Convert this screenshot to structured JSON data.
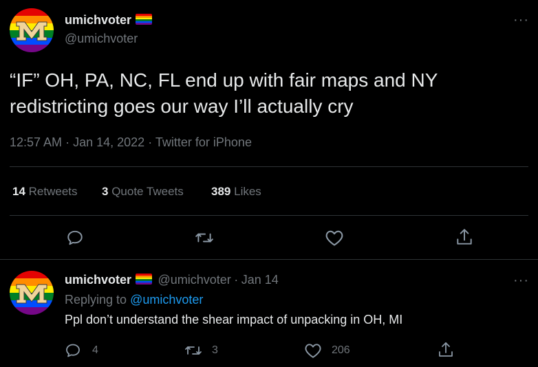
{
  "main_tweet": {
    "display_name": "umichvoter",
    "handle": "@umichvoter",
    "text_line1": "“IF” OH, PA, NC, FL end up with fair maps and NY",
    "text_line2": "redistricting goes our way I’ll actually cry",
    "time": "12:57 AM",
    "date": "Jan 14, 2022",
    "source": "Twitter for iPhone",
    "sep": "·",
    "stats": {
      "retweets_count": "14",
      "retweets_label": "Retweets",
      "quotes_count": "3",
      "quotes_label": "Quote Tweets",
      "likes_count": "389",
      "likes_label": "Likes"
    },
    "more": "···"
  },
  "reply": {
    "display_name": "umichvoter",
    "handle": "@umichvoter",
    "sep": "·",
    "date": "Jan 14",
    "replying_prefix": "Replying to",
    "replying_to": "@umichvoter",
    "text": "Ppl don’t understand the shear impact of unpacking in OH, MI",
    "reply_count": "4",
    "retweet_count": "3",
    "like_count": "206",
    "more": "···"
  },
  "colors": {
    "background": "#000000",
    "text": "#e7e9ea",
    "muted": "#71767b",
    "link": "#1d9bf0",
    "divider": "#2f3336"
  },
  "icons": [
    "michigan-rainbow-avatar",
    "rainbow-flag-icon",
    "more-icon",
    "reply-icon",
    "retweet-icon",
    "like-icon",
    "share-icon"
  ]
}
